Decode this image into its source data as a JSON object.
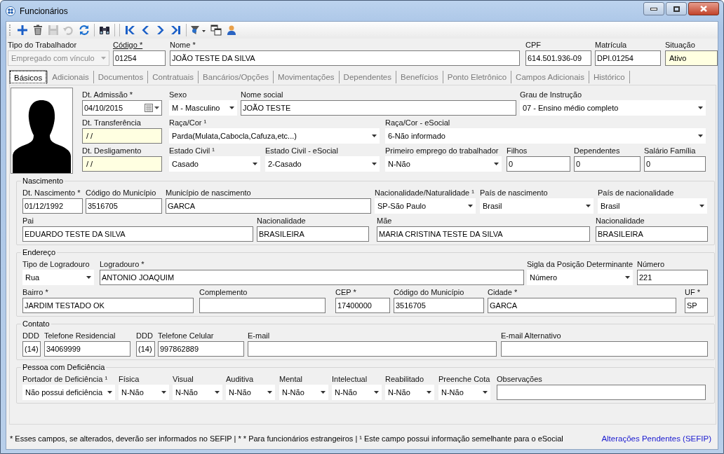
{
  "window": {
    "title": "Funcionários"
  },
  "toolbar": [
    [
      {
        "kind": "add",
        "disabled": false
      },
      {
        "kind": "delete",
        "disabled": false
      },
      {
        "kind": "save",
        "disabled": true
      },
      {
        "kind": "undo",
        "disabled": true
      },
      {
        "kind": "refresh",
        "disabled": false
      }
    ],
    [
      {
        "kind": "search",
        "disabled": false
      }
    ],
    [
      {
        "kind": "first",
        "disabled": false
      },
      {
        "kind": "previous",
        "disabled": false
      },
      {
        "kind": "next",
        "disabled": false
      },
      {
        "kind": "last",
        "disabled": false
      }
    ],
    [
      {
        "kind": "filter",
        "disabled": false
      },
      {
        "kind": "copy",
        "disabled": false
      },
      {
        "kind": "user",
        "disabled": false
      }
    ]
  ],
  "header": [
    {
      "label": "Tipo do Trabalhador",
      "value": "Empregado com vínculo",
      "kind": "select",
      "disabled": true,
      "label_link": false
    },
    {
      "label": "Código *",
      "value": "01254",
      "kind": "text",
      "disabled": false,
      "label_link": true
    },
    {
      "label": "Nome *",
      "value": "JOÃO TESTE DA SILVA",
      "kind": "text",
      "disabled": false,
      "label_link": false
    },
    {
      "label": "CPF",
      "value": "614.501.936-09",
      "kind": "text",
      "disabled": false,
      "label_link": false
    },
    {
      "label": "Matrícula",
      "value": "DPI.01254",
      "kind": "text",
      "disabled": false,
      "label_link": false
    },
    {
      "label": "Situação",
      "value": "Ativo",
      "kind": "marked-text",
      "disabled": false,
      "label_link": false
    }
  ],
  "tabs": [
    {
      "label": "Básicos",
      "selected": true
    },
    {
      "label": "Adicionais",
      "selected": false
    },
    {
      "label": "Documentos",
      "selected": false
    },
    {
      "label": "Contratuais",
      "selected": false
    },
    {
      "label": "Bancários/Opções",
      "selected": false
    },
    {
      "label": "Movimentações",
      "selected": false
    },
    {
      "label": "Dependentes",
      "selected": false
    },
    {
      "label": "Benefícios",
      "selected": false
    },
    {
      "label": "Ponto Eletrônico",
      "selected": false
    },
    {
      "label": "Campos Adicionais",
      "selected": false
    },
    {
      "label": "Histórico",
      "selected": false
    }
  ],
  "personal": [
    [
      {
        "label": "Dt. Admissão *",
        "value": "04/10/2015",
        "kind": "date"
      },
      {
        "label": "Sexo",
        "value": "M - Masculino",
        "kind": "select"
      },
      {
        "label": "Nome social",
        "value": "JOÃO TESTE",
        "kind": "text"
      },
      {
        "label": "Grau de Instrução",
        "value": "07 - Ensino médio completo",
        "kind": "select"
      }
    ],
    [
      {
        "label": "Dt. Transferência",
        "value": "/ /",
        "kind": "marked-text"
      },
      {
        "label": "Raça/Cor ¹",
        "value": "Parda(Mulata,Cabocla,Cafuza,etc...)",
        "kind": "select"
      },
      {
        "label": "Raça/Cor - eSocial",
        "value": "6-Não informado",
        "kind": "select"
      }
    ],
    [
      {
        "label": "Dt. Desligamento",
        "value": "/ /",
        "kind": "marked-text"
      },
      {
        "label": "Estado Civil ¹",
        "value": "Casado",
        "kind": "select"
      },
      {
        "label": "Estado Civil - eSocial",
        "value": "2-Casado",
        "kind": "select"
      },
      {
        "label": "Primeiro emprego do trabalhador",
        "value": "N-Não",
        "kind": "select"
      },
      {
        "label": "Filhos",
        "value": "0",
        "kind": "text"
      },
      {
        "label": "Dependentes",
        "value": "0",
        "kind": "text"
      },
      {
        "label": "Salário Família",
        "value": "0",
        "kind": "text"
      }
    ]
  ],
  "groups": [
    {
      "title": "Nascimento",
      "lines": [
        {
          "fields": [
            {
              "label": "Dt. Nascimento *",
              "value": "01/12/1992",
              "kind": "text"
            },
            {
              "label": "Código do Município",
              "value": "3516705",
              "kind": "text"
            },
            {
              "label": "Município de nascimento",
              "value": "GARCA",
              "kind": "text"
            },
            {
              "label": "Nacionalidade/Naturalidade ¹",
              "value": "SP-São Paulo",
              "kind": "select"
            },
            {
              "label": "País de nascimento",
              "value": "Brasil",
              "kind": "select"
            },
            {
              "label": "País de nacionalidade",
              "value": "Brasil",
              "kind": "select"
            }
          ]
        },
        {
          "fields": [
            {
              "label": "Pai",
              "value": "EDUARDO TESTE DA SILVA",
              "kind": "text"
            },
            {
              "label": "Nacionalidade",
              "value": "BRASILEIRA",
              "kind": "text"
            },
            {
              "label": "Mãe",
              "value": "MARIA CRISTINA TESTE DA SILVA",
              "kind": "text"
            },
            {
              "label": "Nacionalidade",
              "value": "BRASILEIRA",
              "kind": "text"
            }
          ]
        }
      ]
    },
    {
      "title": "Endereço",
      "lines": [
        {
          "fields": [
            {
              "label": "Tipo de Logradouro",
              "value": "Rua",
              "kind": "select"
            },
            {
              "label": "Logradouro *",
              "value": "ANTONIO JOAQUIM",
              "kind": "text"
            },
            {
              "label": "Sigla da Posição Determinante",
              "value": "Número",
              "kind": "select"
            },
            {
              "label": "Número",
              "value": "221",
              "kind": "text"
            }
          ]
        },
        {
          "fields": [
            {
              "label": "Bairro *",
              "value": "JARDIM TESTADO OK",
              "kind": "text"
            },
            {
              "label": "Complemento",
              "kind": "text"
            },
            {
              "label": "CEP *",
              "value": "17400000",
              "kind": "text"
            },
            {
              "label": "Código do Município",
              "value": "3516705",
              "kind": "text"
            },
            {
              "label": "Cidade *",
              "value": "GARCA",
              "kind": "text"
            },
            {
              "label": "UF *",
              "value": "SP",
              "kind": "text"
            }
          ]
        }
      ]
    },
    {
      "title": "Contato",
      "lines": [
        {
          "fields": [
            {
              "label": "DDD",
              "value": "(14)",
              "kind": "text"
            },
            {
              "label": "Telefone Residencial",
              "value": "34069999",
              "kind": "text"
            },
            {
              "label": "DDD",
              "value": "(14)",
              "kind": "text"
            },
            {
              "label": "Telefone Celular",
              "value": "997862889",
              "kind": "text"
            },
            {
              "label": "E-mail",
              "kind": "text"
            },
            {
              "label": "E-mail Alternativo",
              "kind": "text"
            }
          ]
        }
      ]
    },
    {
      "title": "Pessoa com Deficiência",
      "lines": [
        {
          "fields": [
            {
              "label": "Portador de Deficiência ¹",
              "value": "Não possui deficiência",
              "kind": "select"
            },
            {
              "label": "Física",
              "value": "N-Não",
              "kind": "select"
            },
            {
              "label": "Visual",
              "value": "N-Não",
              "kind": "select"
            },
            {
              "label": "Auditiva",
              "value": "N-Não",
              "kind": "select"
            },
            {
              "label": "Mental",
              "value": "N-Não",
              "kind": "select"
            },
            {
              "label": "Intelectual",
              "value": "N-Não",
              "kind": "select"
            },
            {
              "label": "Reabilitado",
              "value": "N-Não",
              "kind": "select"
            },
            {
              "label": "Preenche Cota",
              "value": "N-Não",
              "kind": "select"
            },
            {
              "label": "Observações",
              "kind": "text"
            }
          ]
        }
      ]
    }
  ],
  "footer": {
    "note": "* Esses campos, se alterados, deverão ser informados no SEFIP | * * Para funcionários estrangeiros | ¹ Este campo possui informação semelhante para o eSocial",
    "link": "Alterações Pendentes (SEFIP)"
  }
}
